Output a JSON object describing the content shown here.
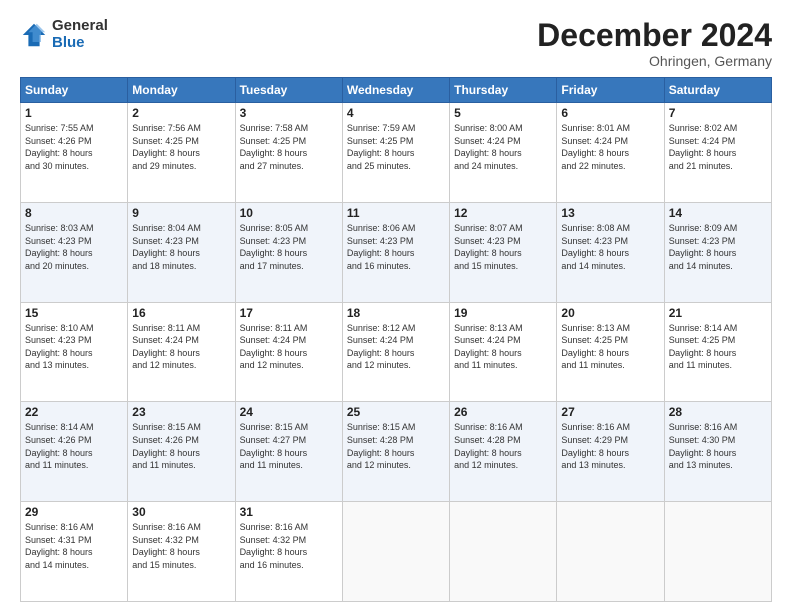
{
  "header": {
    "logo_general": "General",
    "logo_blue": "Blue",
    "month_title": "December 2024",
    "subtitle": "Ohringen, Germany"
  },
  "calendar": {
    "days_of_week": [
      "Sunday",
      "Monday",
      "Tuesday",
      "Wednesday",
      "Thursday",
      "Friday",
      "Saturday"
    ],
    "weeks": [
      [
        {
          "day": "",
          "info": ""
        },
        {
          "day": "2",
          "info": "Sunrise: 7:56 AM\nSunset: 4:25 PM\nDaylight: 8 hours\nand 29 minutes."
        },
        {
          "day": "3",
          "info": "Sunrise: 7:58 AM\nSunset: 4:25 PM\nDaylight: 8 hours\nand 27 minutes."
        },
        {
          "day": "4",
          "info": "Sunrise: 7:59 AM\nSunset: 4:25 PM\nDaylight: 8 hours\nand 25 minutes."
        },
        {
          "day": "5",
          "info": "Sunrise: 8:00 AM\nSunset: 4:24 PM\nDaylight: 8 hours\nand 24 minutes."
        },
        {
          "day": "6",
          "info": "Sunrise: 8:01 AM\nSunset: 4:24 PM\nDaylight: 8 hours\nand 22 minutes."
        },
        {
          "day": "7",
          "info": "Sunrise: 8:02 AM\nSunset: 4:24 PM\nDaylight: 8 hours\nand 21 minutes."
        }
      ],
      [
        {
          "day": "1",
          "info": "Sunrise: 7:55 AM\nSunset: 4:26 PM\nDaylight: 8 hours\nand 30 minutes."
        },
        {
          "day": "",
          "info": ""
        },
        {
          "day": "",
          "info": ""
        },
        {
          "day": "",
          "info": ""
        },
        {
          "day": "",
          "info": ""
        },
        {
          "day": "",
          "info": ""
        },
        {
          "day": "",
          "info": ""
        }
      ],
      [
        {
          "day": "8",
          "info": "Sunrise: 8:03 AM\nSunset: 4:23 PM\nDaylight: 8 hours\nand 20 minutes."
        },
        {
          "day": "9",
          "info": "Sunrise: 8:04 AM\nSunset: 4:23 PM\nDaylight: 8 hours\nand 18 minutes."
        },
        {
          "day": "10",
          "info": "Sunrise: 8:05 AM\nSunset: 4:23 PM\nDaylight: 8 hours\nand 17 minutes."
        },
        {
          "day": "11",
          "info": "Sunrise: 8:06 AM\nSunset: 4:23 PM\nDaylight: 8 hours\nand 16 minutes."
        },
        {
          "day": "12",
          "info": "Sunrise: 8:07 AM\nSunset: 4:23 PM\nDaylight: 8 hours\nand 15 minutes."
        },
        {
          "day": "13",
          "info": "Sunrise: 8:08 AM\nSunset: 4:23 PM\nDaylight: 8 hours\nand 14 minutes."
        },
        {
          "day": "14",
          "info": "Sunrise: 8:09 AM\nSunset: 4:23 PM\nDaylight: 8 hours\nand 14 minutes."
        }
      ],
      [
        {
          "day": "15",
          "info": "Sunrise: 8:10 AM\nSunset: 4:23 PM\nDaylight: 8 hours\nand 13 minutes."
        },
        {
          "day": "16",
          "info": "Sunrise: 8:11 AM\nSunset: 4:24 PM\nDaylight: 8 hours\nand 12 minutes."
        },
        {
          "day": "17",
          "info": "Sunrise: 8:11 AM\nSunset: 4:24 PM\nDaylight: 8 hours\nand 12 minutes."
        },
        {
          "day": "18",
          "info": "Sunrise: 8:12 AM\nSunset: 4:24 PM\nDaylight: 8 hours\nand 12 minutes."
        },
        {
          "day": "19",
          "info": "Sunrise: 8:13 AM\nSunset: 4:24 PM\nDaylight: 8 hours\nand 11 minutes."
        },
        {
          "day": "20",
          "info": "Sunrise: 8:13 AM\nSunset: 4:25 PM\nDaylight: 8 hours\nand 11 minutes."
        },
        {
          "day": "21",
          "info": "Sunrise: 8:14 AM\nSunset: 4:25 PM\nDaylight: 8 hours\nand 11 minutes."
        }
      ],
      [
        {
          "day": "22",
          "info": "Sunrise: 8:14 AM\nSunset: 4:26 PM\nDaylight: 8 hours\nand 11 minutes."
        },
        {
          "day": "23",
          "info": "Sunrise: 8:15 AM\nSunset: 4:26 PM\nDaylight: 8 hours\nand 11 minutes."
        },
        {
          "day": "24",
          "info": "Sunrise: 8:15 AM\nSunset: 4:27 PM\nDaylight: 8 hours\nand 11 minutes."
        },
        {
          "day": "25",
          "info": "Sunrise: 8:15 AM\nSunset: 4:28 PM\nDaylight: 8 hours\nand 12 minutes."
        },
        {
          "day": "26",
          "info": "Sunrise: 8:16 AM\nSunset: 4:28 PM\nDaylight: 8 hours\nand 12 minutes."
        },
        {
          "day": "27",
          "info": "Sunrise: 8:16 AM\nSunset: 4:29 PM\nDaylight: 8 hours\nand 13 minutes."
        },
        {
          "day": "28",
          "info": "Sunrise: 8:16 AM\nSunset: 4:30 PM\nDaylight: 8 hours\nand 13 minutes."
        }
      ],
      [
        {
          "day": "29",
          "info": "Sunrise: 8:16 AM\nSunset: 4:31 PM\nDaylight: 8 hours\nand 14 minutes."
        },
        {
          "day": "30",
          "info": "Sunrise: 8:16 AM\nSunset: 4:32 PM\nDaylight: 8 hours\nand 15 minutes."
        },
        {
          "day": "31",
          "info": "Sunrise: 8:16 AM\nSunset: 4:32 PM\nDaylight: 8 hours\nand 16 minutes."
        },
        {
          "day": "",
          "info": ""
        },
        {
          "day": "",
          "info": ""
        },
        {
          "day": "",
          "info": ""
        },
        {
          "day": "",
          "info": ""
        }
      ]
    ]
  }
}
